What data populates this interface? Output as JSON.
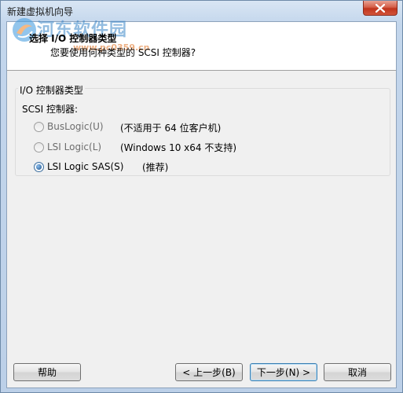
{
  "window": {
    "title": "新建虚拟机向导"
  },
  "watermark": {
    "site_name": "河东软件园",
    "url": "www.pc0359.cn"
  },
  "header": {
    "title": "选择 I/O 控制器类型",
    "subtitle": "您要使用何种类型的 SCSI 控制器?"
  },
  "group": {
    "legend": "I/O 控制器类型",
    "sublabel": "SCSI 控制器:",
    "options": [
      {
        "label": "BusLogic(U)",
        "note": "(不适用于 64 位客户机)",
        "selected": false,
        "enabled": false
      },
      {
        "label": "LSI Logic(L)",
        "note": "(Windows 10 x64 不支持)",
        "selected": false,
        "enabled": false
      },
      {
        "label": "LSI Logic SAS(S)",
        "note": "(推荐)",
        "selected": true,
        "enabled": true
      }
    ]
  },
  "footer": {
    "help_label": "帮助",
    "back_label": "< 上一步(B)",
    "next_label": "下一步(N) >",
    "cancel_label": "取消"
  },
  "icons": {
    "close": "close-icon",
    "radio_checked": "radio-checked-icon",
    "radio_unchecked": "radio-unchecked-icon"
  },
  "colors": {
    "close_button": "#c0341c",
    "header_bg": "#ffffff",
    "dialog_bg": "#f0f0f0",
    "frame": "#c3d6ec"
  }
}
